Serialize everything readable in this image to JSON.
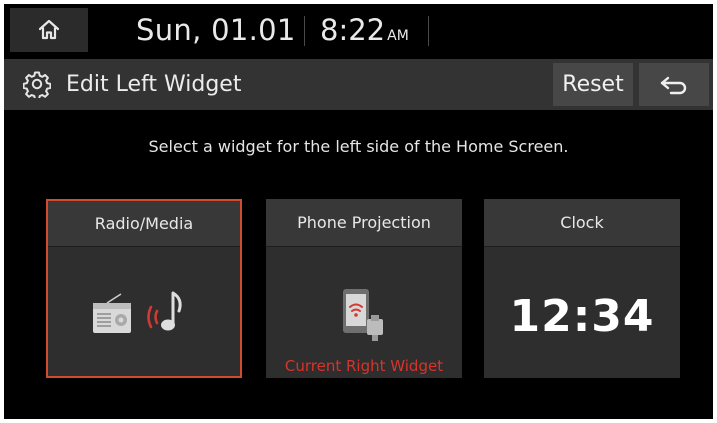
{
  "status_bar": {
    "home_icon": "home-icon",
    "date": "Sun, 01.01",
    "time": "8:22",
    "ampm": "AM"
  },
  "title_bar": {
    "icon": "gear-icon",
    "title": "Edit Left Widget",
    "reset_label": "Reset",
    "back_icon": "back-arrow-icon"
  },
  "instruction": "Select a widget for the left side of the Home Screen.",
  "widgets": [
    {
      "title": "Radio/Media",
      "icon": "radio-media-icon",
      "selected": true
    },
    {
      "title": "Phone Projection",
      "icon": "phone-projection-icon",
      "status": "Current Right Widget"
    },
    {
      "title": "Clock",
      "clock_value": "12:34"
    }
  ],
  "colors": {
    "selected_border": "#d24b2f",
    "status_red": "#d8332a",
    "card_bg": "#2e2e2e",
    "title_bar_bg": "#333333"
  }
}
